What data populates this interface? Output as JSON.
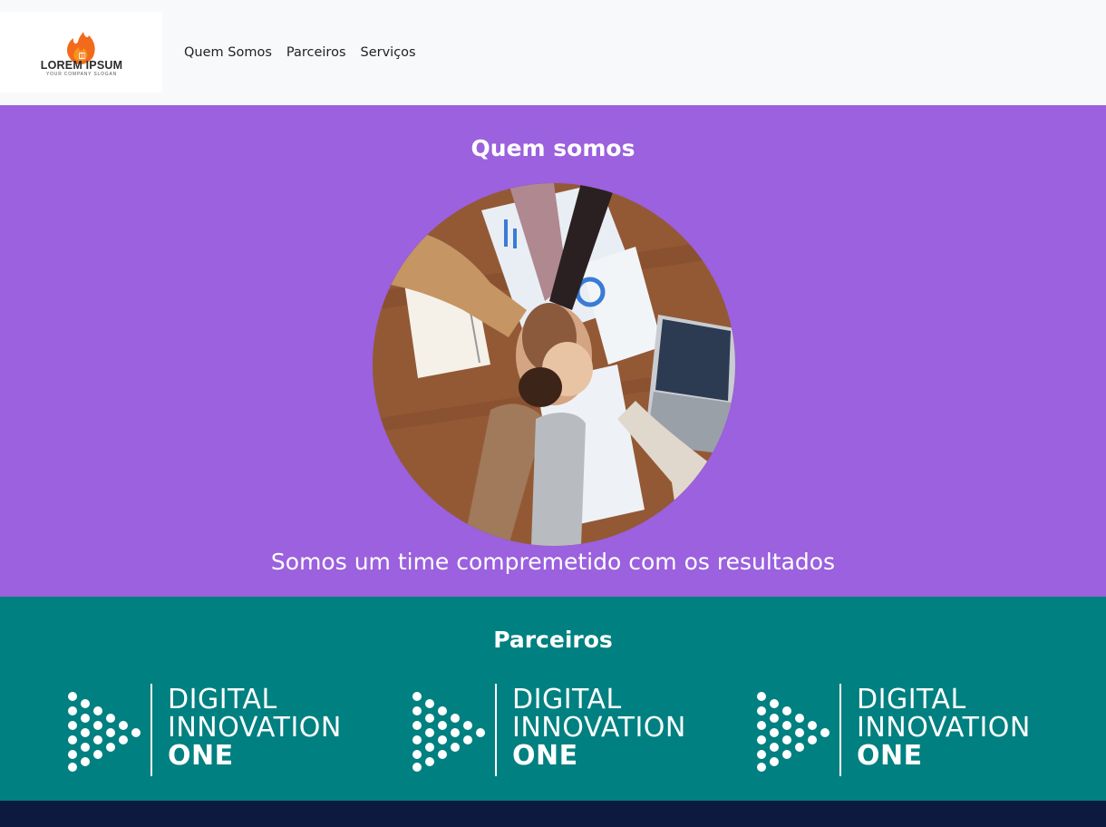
{
  "navbar": {
    "logo": {
      "name": "LOREM IPSUM",
      "slogan": "YOUR COMPANY SLOGAN"
    },
    "links": [
      "Quem Somos",
      "Parceiros",
      "Serviços"
    ]
  },
  "quem_somos": {
    "title": "Quem somos",
    "subtitle": "Somos um time compremetido com os resultados",
    "background": "#9b61de"
  },
  "parceiros": {
    "title": "Parceiros",
    "background": "#008080",
    "partners": [
      {
        "line1": "DIGITAL",
        "line2": "INNOVATION",
        "line3": "ONE"
      },
      {
        "line1": "DIGITAL",
        "line2": "INNOVATION",
        "line3": "ONE"
      },
      {
        "line1": "DIGITAL",
        "line2": "INNOVATION",
        "line3": "ONE"
      }
    ]
  },
  "footer": {
    "background": "#0d1a40"
  }
}
